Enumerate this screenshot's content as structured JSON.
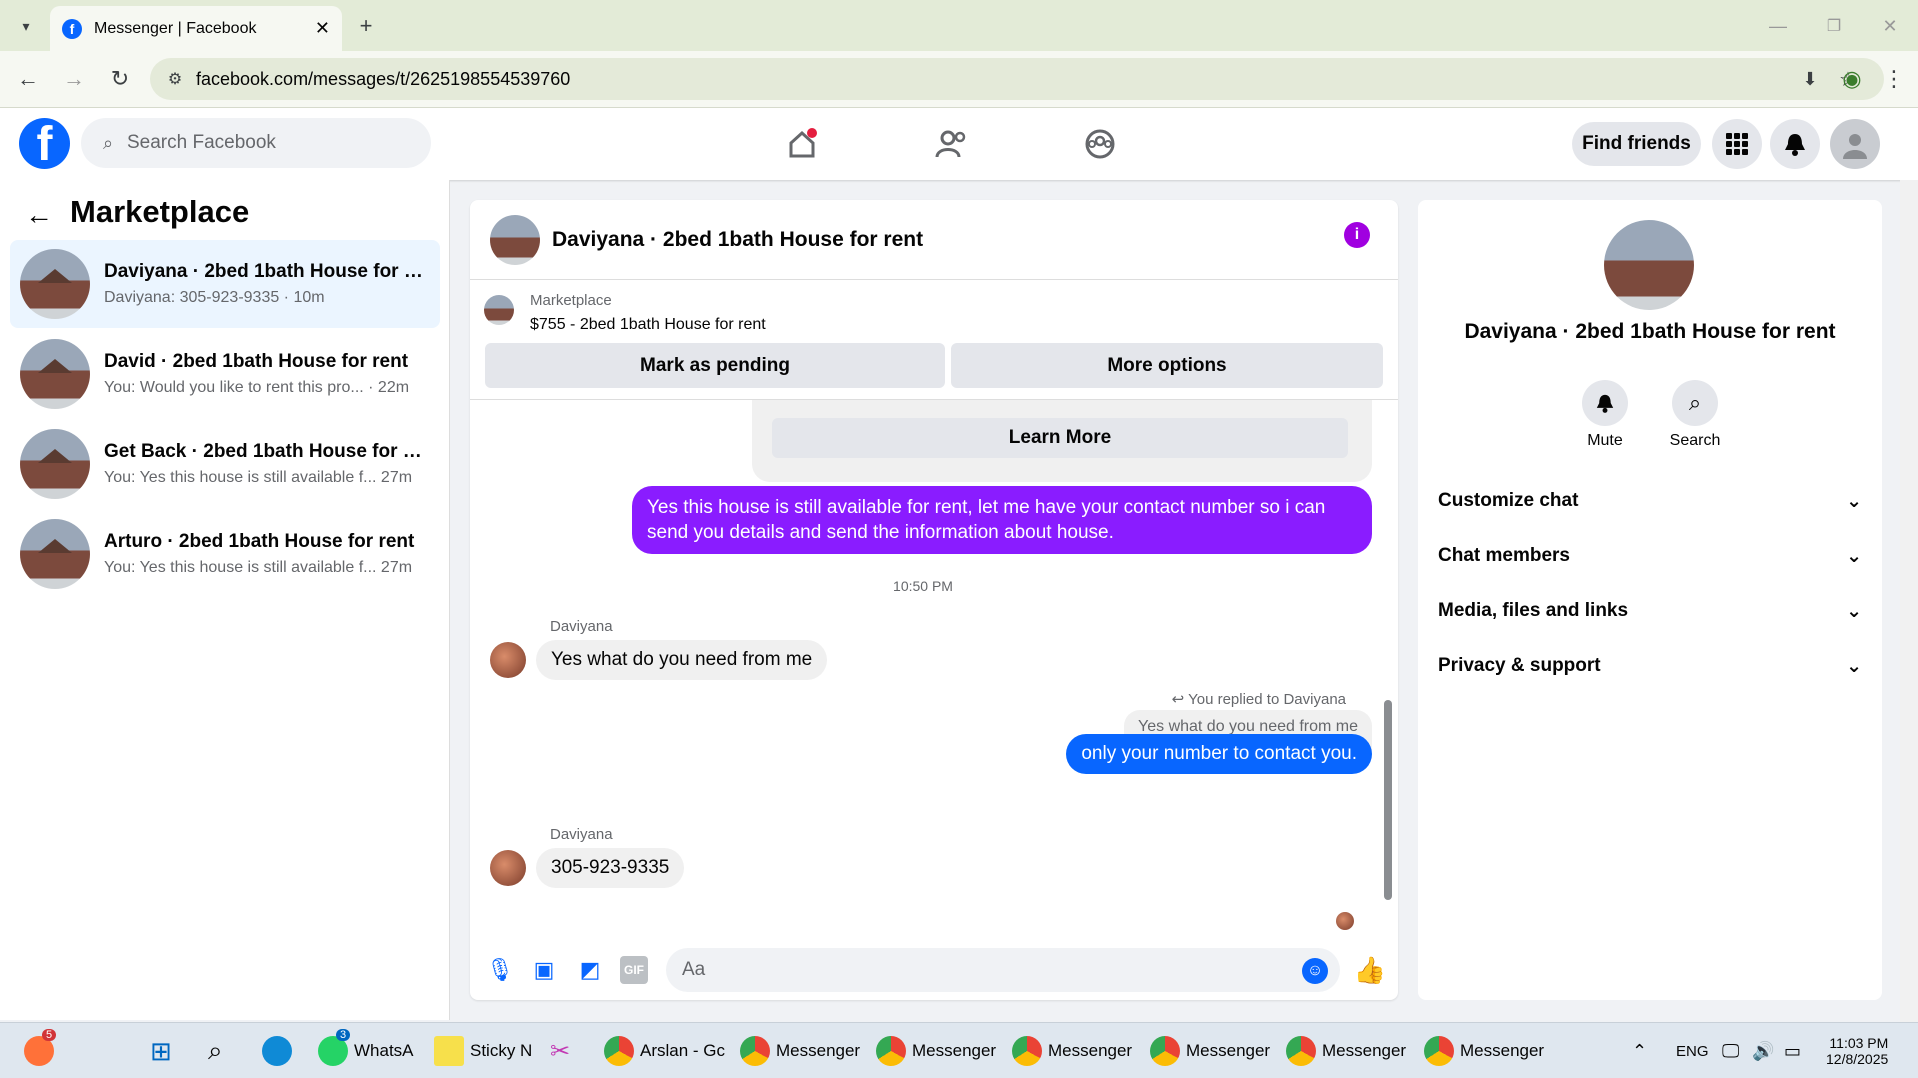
{
  "browser": {
    "tab_title": "Messenger | Facebook",
    "url": "facebook.com/messages/t/2625198554539760"
  },
  "fb": {
    "search_placeholder": "Search Facebook",
    "find_friends": "Find friends"
  },
  "left": {
    "title": "Marketplace",
    "conversations": [
      {
        "name": "Daviyana · 2bed 1bath House for r...",
        "sub": "Daviyana: 305-923-9335 · 10m"
      },
      {
        "name": "David · 2bed 1bath House for rent",
        "sub": "You: Would you like to rent this pro... · 22m"
      },
      {
        "name": "Get Back · 2bed 1bath House for re...",
        "sub": "You: Yes this house is still available f...   27m"
      },
      {
        "name": "Arturo · 2bed 1bath House for rent",
        "sub": "You: Yes this house is still available f...   27m"
      }
    ]
  },
  "chat": {
    "title": "Daviyana · 2bed 1bath House for rent",
    "marketplace_label": "Marketplace",
    "listing": "$755 - 2bed 1bath House for rent",
    "mark_pending": "Mark as pending",
    "more_options": "More options",
    "learn_more": "Learn More",
    "msg_out1": "Yes this house is still available for rent, let me have your contact number so i can send you details and send the information about house.",
    "time": "10:50 PM",
    "sender": "Daviyana",
    "msg_in1": "Yes what do you need from me",
    "replied": "You replied to Daviyana",
    "quoted": "Yes what do you need from me",
    "msg_out2": "only your number to contact you.",
    "msg_in2": "305-923-9335",
    "composer_placeholder": "Aa"
  },
  "right": {
    "title": "Daviyana · 2bed 1bath House for rent",
    "mute": "Mute",
    "search": "Search",
    "sections": [
      "Customize chat",
      "Chat members",
      "Media, files and links",
      "Privacy & support"
    ]
  },
  "taskbar": {
    "items": [
      "WhatsA",
      "Sticky N",
      "Arslan - Gc",
      "Messenger",
      "Messenger",
      "Messenger",
      "Messenger",
      "Messenger",
      "Messenger"
    ],
    "lang": "ENG",
    "time": "11:03 PM",
    "date": "12/8/2025",
    "badge1": "5",
    "badge2": "3"
  },
  "colors": {
    "fb_blue": "#0866ff",
    "purple": "#8a1cff"
  }
}
